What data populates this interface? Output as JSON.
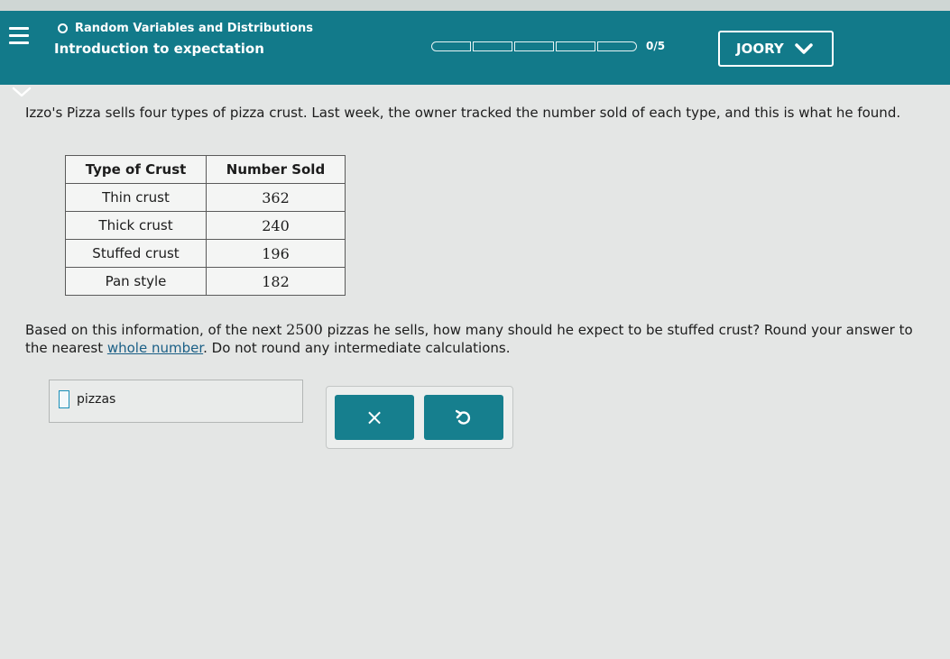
{
  "header": {
    "topic": "Random Variables and Distributions",
    "subtitle": "Introduction to expectation",
    "progress_text": "0/5",
    "progress_value": 0,
    "progress_total": 5,
    "user_name": "JOORY"
  },
  "question": {
    "intro": "Izzo's Pizza sells four types of pizza crust. Last week, the owner tracked the number sold of each type, and this is what he found."
  },
  "table": {
    "headers": [
      "Type of Crust",
      "Number Sold"
    ],
    "rows": [
      [
        "Thin crust",
        "362"
      ],
      [
        "Thick crust",
        "240"
      ],
      [
        "Stuffed crust",
        "196"
      ],
      [
        "Pan style",
        "182"
      ]
    ]
  },
  "prompt": {
    "part1": "Based on this information, of the next ",
    "number": "2500",
    "part2": " pizzas he sells, how many should he expect to be stuffed crust? Round your answer to the nearest ",
    "link": "whole number",
    "part3": ". Do not round any intermediate calculations."
  },
  "answer": {
    "value": "",
    "unit": "pizzas"
  },
  "buttons": {
    "clear_label": "×",
    "undo_icon": "undo-icon"
  },
  "colors": {
    "header_bg": "#127a8a",
    "button_bg": "#167f8e",
    "link": "#1a5f86"
  }
}
